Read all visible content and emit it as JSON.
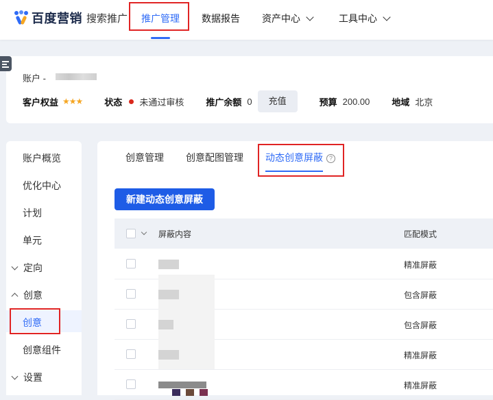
{
  "header": {
    "brand": "百度营销",
    "brand_sub": "搜索推广",
    "nav": [
      {
        "label": "推广管理",
        "active": true
      },
      {
        "label": "数据报告"
      },
      {
        "label": "资产中心"
      },
      {
        "label": "工具中心"
      }
    ]
  },
  "account": {
    "label": "账户 -",
    "rights_label": "客户权益",
    "stars": "★★★",
    "status_label": "状态",
    "status_value": "未通过审核",
    "balance_label": "推广余额",
    "balance_value": "0",
    "recharge_label": "充值",
    "budget_label": "预算",
    "budget_value": "200.00",
    "region_label": "地域",
    "region_value": "北京"
  },
  "sidebar": {
    "items": [
      {
        "label": "账户概览"
      },
      {
        "label": "优化中心"
      },
      {
        "label": "计划"
      },
      {
        "label": "单元"
      },
      {
        "label": "定向"
      },
      {
        "label": "创意"
      },
      {
        "label": "创意",
        "active": true
      },
      {
        "label": "创意组件"
      },
      {
        "label": "设置"
      }
    ]
  },
  "main": {
    "tabs": [
      {
        "label": "创意管理"
      },
      {
        "label": "创意配图管理"
      },
      {
        "label": "动态创意屏蔽",
        "active": true
      }
    ],
    "help_glyph": "?",
    "new_button": "新建动态创意屏蔽",
    "table": {
      "columns": [
        "屏蔽内容",
        "匹配模式"
      ],
      "rows": [
        {
          "match": "精准屏蔽"
        },
        {
          "match": "包含屏蔽"
        },
        {
          "match": "包含屏蔽"
        },
        {
          "match": "精准屏蔽"
        },
        {
          "match": "精准屏蔽"
        }
      ]
    }
  },
  "colors": {
    "accent": "#2f6bf6",
    "button": "#1e5ce6",
    "highlight_box": "#e02323",
    "status_fail": "#d9281c",
    "star": "#f5a623"
  },
  "icons": [
    "baidu-logo-icon",
    "chevron-down-icon",
    "menu-icon",
    "help-icon",
    "chevron-up-icon"
  ]
}
